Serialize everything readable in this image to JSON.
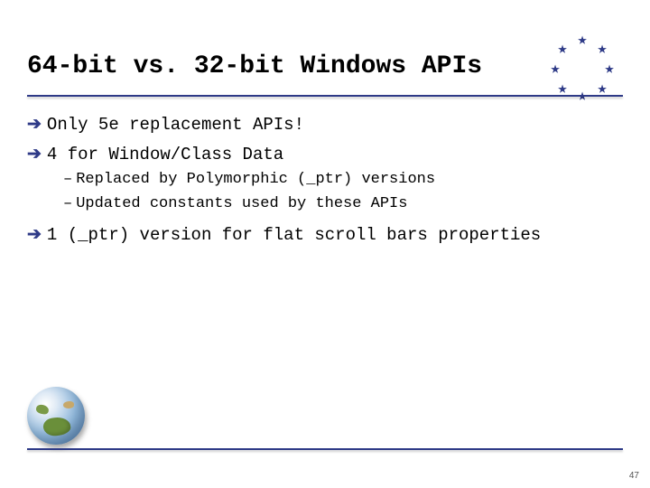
{
  "title": "64-bit vs. 32-bit Windows APIs",
  "bullets": [
    {
      "text": "Only 5e replacement APIs!"
    },
    {
      "text": "4 for Window/Class Data"
    }
  ],
  "subbullets": [
    {
      "text": "Replaced by Polymorphic (_ptr) versions"
    },
    {
      "text": "Updated constants used by these APIs"
    }
  ],
  "bullets2": [
    {
      "text": "1 (_ptr) version for flat scroll bars properties"
    }
  ],
  "pageNumber": "47",
  "colors": {
    "accent": "#2e3a87"
  }
}
